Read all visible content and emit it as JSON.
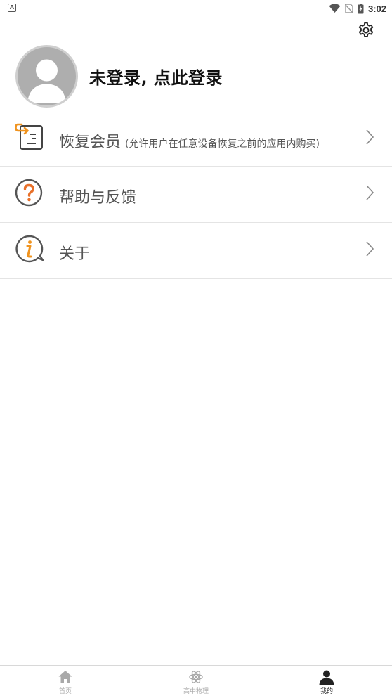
{
  "status_bar": {
    "left_badge": "A",
    "time": "3:02",
    "icons": [
      "wifi-icon",
      "no-sim-icon",
      "battery-charging-icon"
    ]
  },
  "header": {
    "settings_icon": "gear-icon"
  },
  "profile": {
    "login_prompt": "未登录, 点此登录",
    "avatar_icon": "default-avatar-icon"
  },
  "menu": {
    "items": [
      {
        "id": "restore-membership",
        "label": "恢复会员",
        "sublabel": "(允许用户在任意设备恢复之前的应用内购买)",
        "icon": "restore-icon"
      },
      {
        "id": "help-feedback",
        "label": "帮助与反馈",
        "icon": "question-icon"
      },
      {
        "id": "about",
        "label": "关于",
        "icon": "info-bubble-icon"
      }
    ]
  },
  "tab_bar": {
    "tabs": [
      {
        "label": "首页",
        "icon": "home-icon",
        "active": false
      },
      {
        "label": "高中物理",
        "icon": "atom-icon",
        "active": false
      },
      {
        "label": "我的",
        "icon": "person-icon",
        "active": true
      }
    ]
  },
  "colors": {
    "accent_orange": "#F0931E",
    "question_orange": "#E8702A",
    "icon_gray": "#555555",
    "divider": "#E4E4E4",
    "avatar_gray": "#AEAEAE"
  }
}
